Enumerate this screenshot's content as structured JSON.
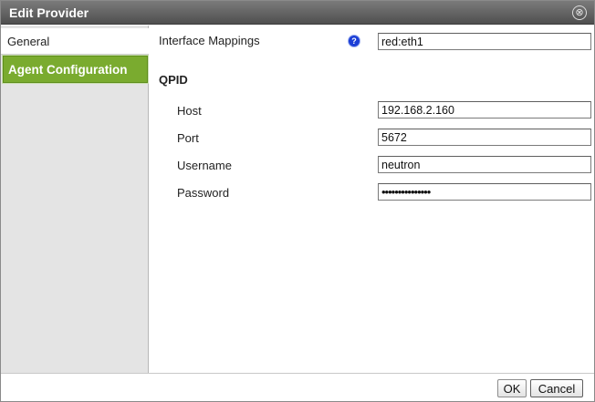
{
  "window": {
    "title": "Edit Provider",
    "close_glyph": "⊗"
  },
  "sidebar": {
    "items": [
      {
        "label": "General"
      },
      {
        "label": "Agent Configuration"
      }
    ]
  },
  "form": {
    "interface_mappings": {
      "label": "Interface Mappings",
      "help_glyph": "?",
      "value": "red:eth1"
    },
    "section_title": "QPID",
    "host": {
      "label": "Host",
      "value": "192.168.2.160"
    },
    "port": {
      "label": "Port",
      "value": "5672"
    },
    "username": {
      "label": "Username",
      "value": "neutron"
    },
    "password": {
      "label": "Password",
      "value": "•••••••••••••••"
    }
  },
  "footer": {
    "ok_label": "OK",
    "cancel_label": "Cancel"
  },
  "colors": {
    "selected_nav": "#7aab2f",
    "help_icon": "#1b3ed6",
    "titlebar": "#5f5f5f"
  }
}
